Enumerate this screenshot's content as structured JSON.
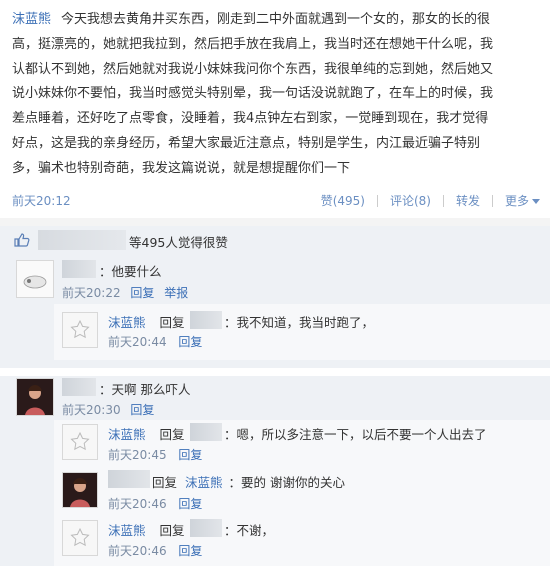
{
  "post": {
    "author": "沫蓝熊",
    "lines": [
      "今天我想去黄角井买东西，刚走到二中外面就遇到一个女的，那女的长的很",
      "高，挺漂亮的，她就把我拉到，然后把手放在我肩上，我当时还在想她干什么呢，我",
      "认都认不到她，然后她就对我说小妹妹我问你个东西，我很单纯的忘到她，然后她又",
      "说小妹妹你不要怕，我当时感觉头特别晕，我一句话没说就跑了，在车上的时候，我",
      "差点睡着，还好吃了点零食，没睡着，我4点钟左右到家，一觉睡到现在，我才觉得",
      "好点，这是我的亲身经历，希望大家最近注意点，特别是学生，内江最近骗子特别",
      "多，骗术也特别奇葩，我发这篇说说，就是想提醒你们一下"
    ],
    "time": "前天20:12",
    "actions": {
      "like": "赞(495)",
      "comment": "评论(8)",
      "forward": "转发",
      "more": "更多"
    }
  },
  "likes": {
    "text": "等495人觉得很赞"
  },
  "comments": [
    {
      "text": "：他要什么",
      "time": "前天20:22",
      "reply": "回复",
      "report": "举报",
      "replies": [
        {
          "author": "沫蓝熊",
          "reply_word": "回复",
          "text": "：我不知道，我当时跑了，",
          "time": "前天20:44",
          "reply": "回复"
        }
      ]
    },
    {
      "text": "：天啊 那么吓人",
      "time": "前天20:30",
      "reply": "回复",
      "replies": [
        {
          "author": "沫蓝熊",
          "reply_word": "回复",
          "text": "：嗯，所以多注意一下，以后不要一个人出去了",
          "time": "前天20:45",
          "reply": "回复"
        },
        {
          "reply_word": "回复",
          "target": "沫蓝熊",
          "text": "：要的 谢谢你的关心",
          "time": "前天20:46",
          "reply": "回复"
        },
        {
          "author": "沫蓝熊",
          "reply_word": "回复",
          "text": "：不谢，",
          "time": "前天20:46",
          "reply": "回复"
        }
      ]
    }
  ]
}
